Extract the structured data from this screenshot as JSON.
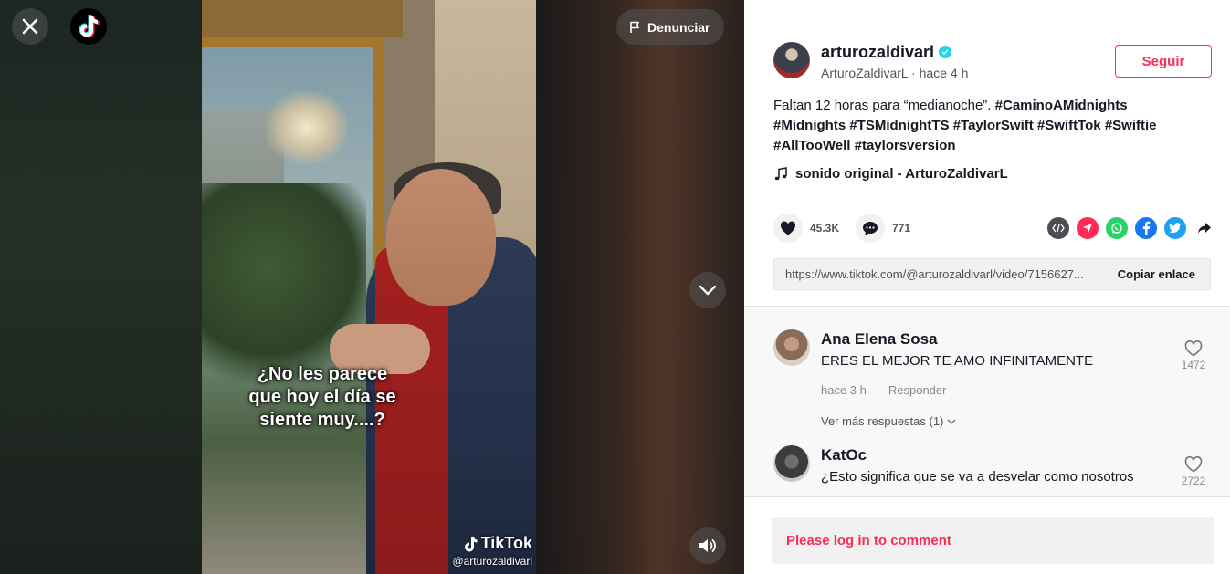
{
  "header": {
    "report_label": "Denunciar"
  },
  "video": {
    "caption_line1": "¿No les parece",
    "caption_line2": "que hoy el día se",
    "caption_line3": "siente muy....?",
    "watermark_brand": "TikTok",
    "watermark_handle": "@arturozaldivarl"
  },
  "author": {
    "username": "arturozaldivarl",
    "display_name": "ArturoZaldivarL",
    "separator": " · ",
    "posted": "hace 4 h",
    "follow_label": "Seguir"
  },
  "post": {
    "text": "Faltan 12 horas para “medianoche”. ",
    "hashtags": [
      "#CaminoAMidnights",
      "#Midnights",
      "#TSMidnightTS",
      "#TaylorSwift",
      "#SwiftTok",
      "#Swiftie",
      "#AllTooWell",
      "#taylorsversion"
    ],
    "music": "sonido original - ArturoZaldivarL"
  },
  "stats": {
    "likes": "45.3K",
    "comments": "771"
  },
  "share": {
    "icons": [
      "embed-icon",
      "send-icon",
      "whatsapp-icon",
      "facebook-icon",
      "twitter-icon",
      "share-icon"
    ]
  },
  "link": {
    "url": "https://www.tiktok.com/@arturozaldivarl/video/7156627...",
    "copy_label": "Copiar enlace"
  },
  "comments": [
    {
      "name": "Ana Elena Sosa",
      "text": "ERES EL MEJOR TE AMO INFINITAMENTE",
      "time": "hace 3 h",
      "reply_label": "Responder",
      "likes": "1472",
      "more_replies": "Ver más respuestas (1)"
    },
    {
      "name": "KatOc",
      "text": "¿Esto significa que se va a desvelar como nosotros",
      "likes": "2722"
    }
  ],
  "comment_bar": {
    "login_prompt": "Please log in to comment"
  },
  "colors": {
    "accent": "#fe2c55",
    "verified": "#20d5ec",
    "whatsapp": "#25d366",
    "facebook": "#1877f2",
    "twitter": "#1da1f2"
  }
}
